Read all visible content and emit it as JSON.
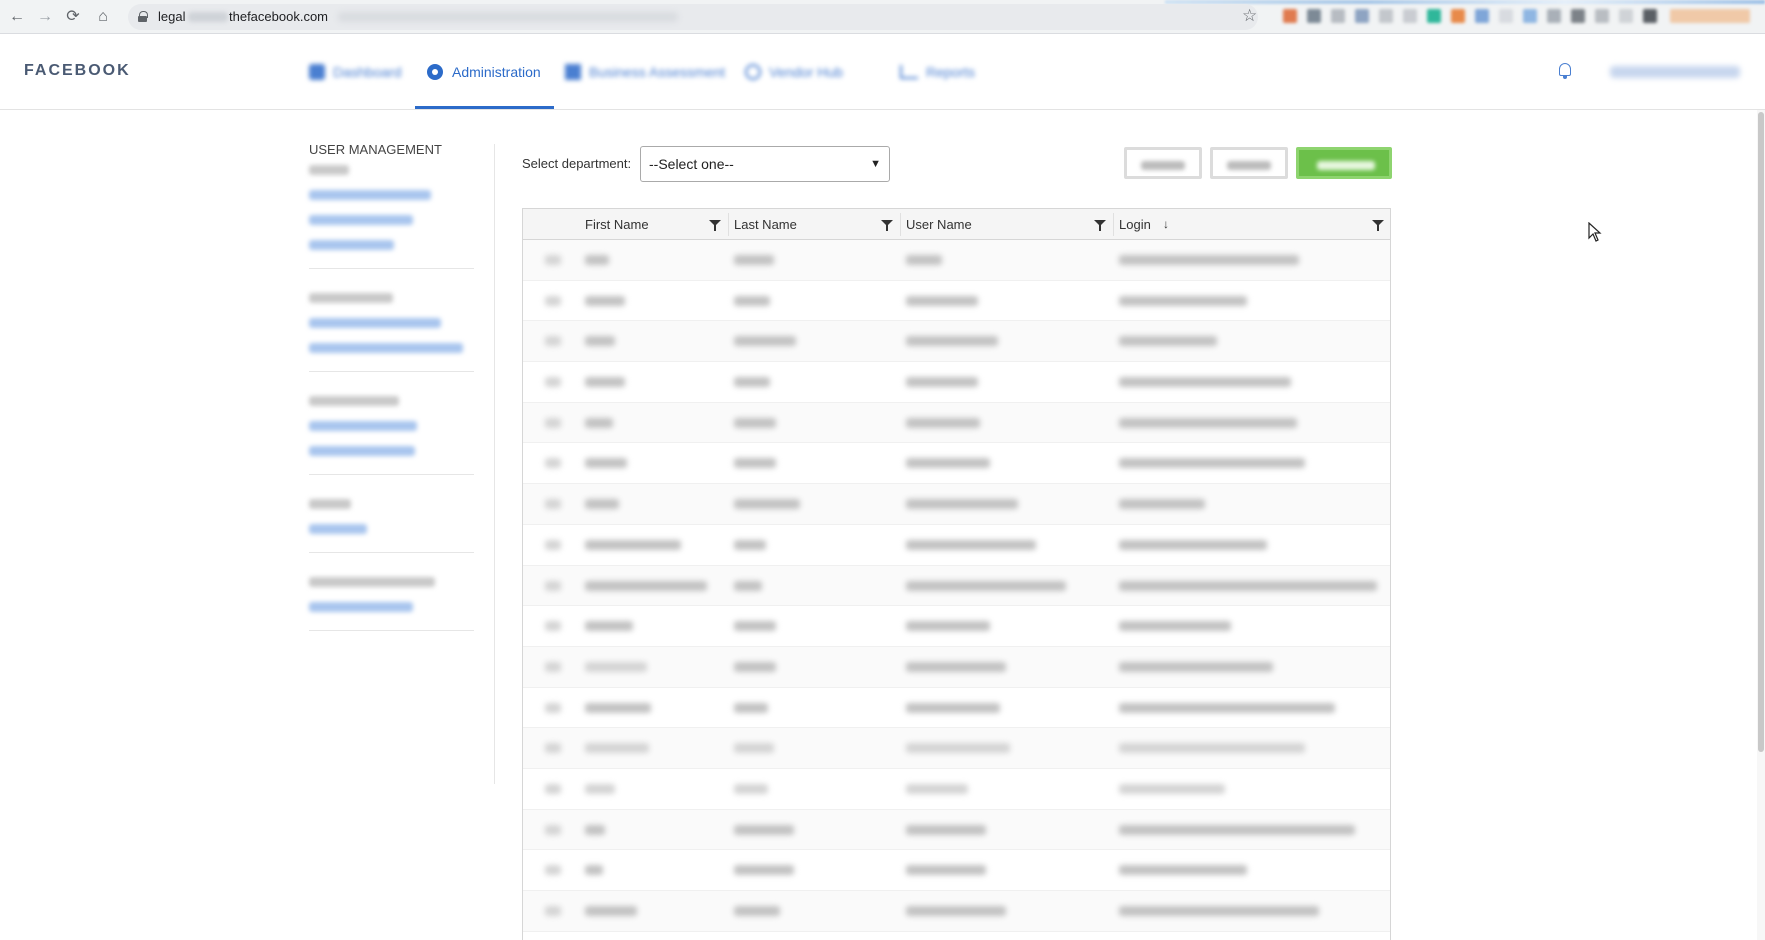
{
  "browser": {
    "url_prefix": "legal",
    "url_domain": "thefacebook.com",
    "nav": {
      "back": "←",
      "forward": "→",
      "reload": "⟳",
      "home": "⌂"
    },
    "star": "☆"
  },
  "header": {
    "brand": "FACEBOOK",
    "tabs": [
      {
        "label": "Dashboard",
        "blurred": true
      },
      {
        "label": "Administration",
        "active": true
      },
      {
        "label": "Business Assessment",
        "blurred": true
      },
      {
        "label": "Vendor Hub",
        "blurred": true
      },
      {
        "label": "Reports",
        "blurred": true
      }
    ]
  },
  "sidebar": {
    "heading": "USER MANAGEMENT"
  },
  "toolbar": {
    "dept_label": "Select department:",
    "dept_value": "--Select one--"
  },
  "grid": {
    "columns": [
      "First Name",
      "Last Name",
      "User Name",
      "Login"
    ],
    "sort_indicator": "↓",
    "row_count": 17
  },
  "colors": {
    "accent": "#2c6bc9",
    "primary_button": "#6cc04a",
    "link_blur": "#9fbfe8"
  }
}
